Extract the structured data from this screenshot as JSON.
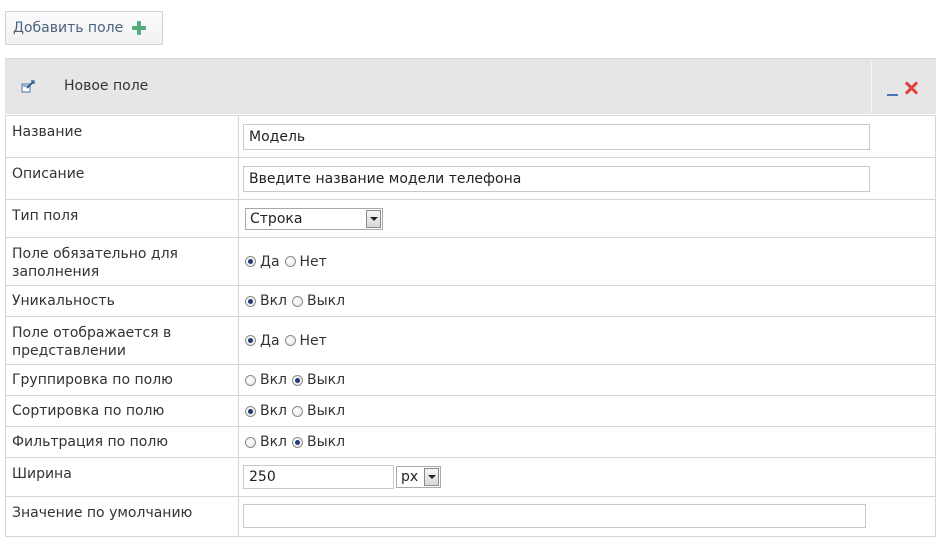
{
  "add_field": {
    "label": "Добавить поле",
    "icon": "plus-icon",
    "icon_color": "#56ad7c"
  },
  "panel": {
    "title": "Новое поле",
    "minimize_color": "#4a76b8",
    "close_color": "#e04040"
  },
  "fields": {
    "name": {
      "label": "Название",
      "value": "Модель"
    },
    "description": {
      "label": "Описание",
      "value": "Введите название модели телефона"
    },
    "type": {
      "label": "Тип поля",
      "selected": "Строка"
    },
    "required": {
      "label": "Поле обязательно для заполнения",
      "opt_yes": "Да",
      "opt_no": "Нет",
      "selected": "Да"
    },
    "unique": {
      "label": "Уникальность",
      "opt_on": "Вкл",
      "opt_off": "Выкл",
      "selected": "Вкл"
    },
    "shown": {
      "label": "Поле отображается в представлении",
      "opt_yes": "Да",
      "opt_no": "Нет",
      "selected": "Да"
    },
    "grouping": {
      "label": "Группировка по полю",
      "opt_on": "Вкл",
      "opt_off": "Выкл",
      "selected": "Выкл"
    },
    "sorting": {
      "label": "Сортировка по полю",
      "opt_on": "Вкл",
      "opt_off": "Выкл",
      "selected": "Вкл"
    },
    "filtering": {
      "label": "Фильтрация по полю",
      "opt_on": "Вкл",
      "opt_off": "Выкл",
      "selected": "Выкл"
    },
    "width": {
      "label": "Ширина",
      "value": "250",
      "unit": "px"
    },
    "default_value": {
      "label": "Значение по умолчанию",
      "value": ""
    }
  }
}
